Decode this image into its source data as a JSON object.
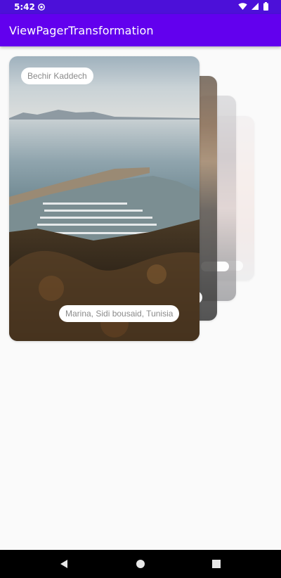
{
  "status_bar": {
    "time": "5:42",
    "icons": [
      "sync-dot-icon",
      "wifi-icon",
      "signal-icon",
      "battery-icon"
    ],
    "background": "#4c10d9"
  },
  "app_bar": {
    "title": "ViewPagerTransformation",
    "background": "#6200ee"
  },
  "pager": {
    "current_card": {
      "author": "Bechir Kaddech",
      "location": "Marina, Sidi bousaid, Tunisia"
    }
  },
  "nav_bar": {
    "buttons": [
      "back-icon",
      "home-icon",
      "recents-icon"
    ]
  }
}
